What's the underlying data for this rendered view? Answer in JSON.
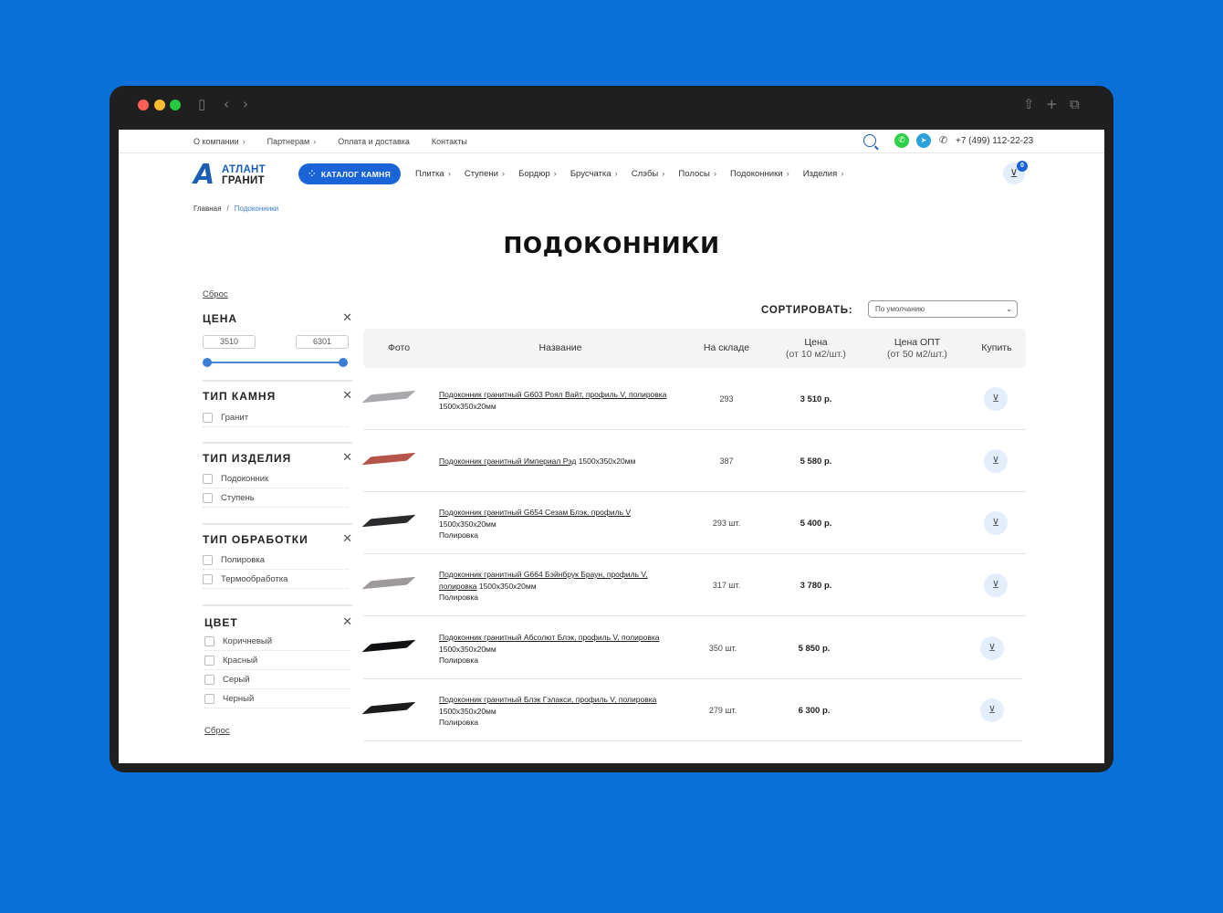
{
  "top_links": [
    {
      "label": "О компании",
      "chevron": true
    },
    {
      "label": "Партнерам",
      "chevron": true
    },
    {
      "label": "Оплата и доставка",
      "chevron": false
    },
    {
      "label": "Контакты",
      "chevron": false
    }
  ],
  "phone": "+7 (499) 112-22-23",
  "logo": {
    "mark": "А",
    "line1": "АТЛАНТ",
    "line2": "ГРАНИТ"
  },
  "catalog_button": "КАТАЛОГ КАМНЯ",
  "main_nav": [
    "Плитка",
    "Ступени",
    "Бордюр",
    "Брусчатка",
    "Слэбы",
    "Полосы",
    "Подоконники",
    "Изделия"
  ],
  "cart_count": "0",
  "breadcrumb": {
    "home": "Главная",
    "sep": "/",
    "current": "Подоконники"
  },
  "page_title": "ПОДОКОННИКИ",
  "filters": {
    "reset_label": "Сброс",
    "price": {
      "title": "ЦЕНА",
      "min": "3510",
      "max": "6301",
      "range_selected": [
        0,
        1
      ]
    },
    "stone_type": {
      "title": "ТИП КАМНЯ",
      "options": [
        "Гранит"
      ]
    },
    "product_type": {
      "title": "ТИП ИЗДЕЛИЯ",
      "options": [
        "Подоконник",
        "Ступень"
      ]
    },
    "processing": {
      "title": "ТИП ОБРАБОТКИ",
      "options": [
        "Полировка",
        "Термообработка"
      ]
    },
    "color": {
      "title": "ЦВЕТ",
      "options": [
        "Коричневый",
        "Красный",
        "Серый",
        "Черный"
      ]
    }
  },
  "sort": {
    "label": "СОРТИРОВАТЬ:",
    "value": "По умолчанию"
  },
  "table": {
    "headers": {
      "photo": "Фото",
      "name": "Название",
      "stock": "На складе",
      "price": "Цена",
      "price_sub": "(от 10 м2/шт.)",
      "wholesale": "Цена ОПТ",
      "wholesale_sub": "(от 50 м2/шт.)",
      "buy": "Купить"
    },
    "rows": [
      {
        "link": "Подоконник гранитный G603 Роял Вайт, профиль V, полировка",
        "size": "1500x350x20мм",
        "finish": "",
        "stock": "293",
        "price": "3 510 р.",
        "color": "#a9a9ad"
      },
      {
        "link": "Подоконник гранитный Империал Рэд",
        "size": "1500x350x20мм",
        "finish": "",
        "stock": "387",
        "price": "5 580 р.",
        "color": "#b4544b"
      },
      {
        "link": "Подоконник гранитный G654 Сезам Блэк, профиль V",
        "size": "1500x350x20мм",
        "finish": "Полировка",
        "stock": "293 шт.",
        "price": "5 400 р.",
        "color": "#2b2b2e"
      },
      {
        "link": "Подоконник гранитный G664 Бэйнбрук Браун, профиль V, полировка",
        "size": "1500x350x20мм",
        "finish": "Полировка",
        "stock": "317 шт.",
        "price": "3 780 р.",
        "color": "#9e9a9c"
      },
      {
        "link": "Подоконник гранитный Абсолют Блэк, профиль V, полировка",
        "size": "1500x350x20мм",
        "finish": "Полировка",
        "stock": "350 шт.",
        "price": "5 850 р.",
        "color": "#111113"
      },
      {
        "link": "Подоконник гранитный Блэк Гэлакси, профиль V, полировка",
        "size": "1500x350x20мм",
        "finish": "Полировка",
        "stock": "279 шт.",
        "price": "6 300 р.",
        "color": "#1c1c1f"
      }
    ]
  },
  "icons": {
    "search": "search-icon",
    "whatsapp": "whatsapp-icon",
    "telegram": "telegram-icon",
    "phone": "phone-icon",
    "cart": "cart-icon",
    "basket": "basket-icon",
    "close": "close-icon"
  },
  "colors": {
    "accent": "#1a64d8",
    "background": "#0870d8"
  }
}
